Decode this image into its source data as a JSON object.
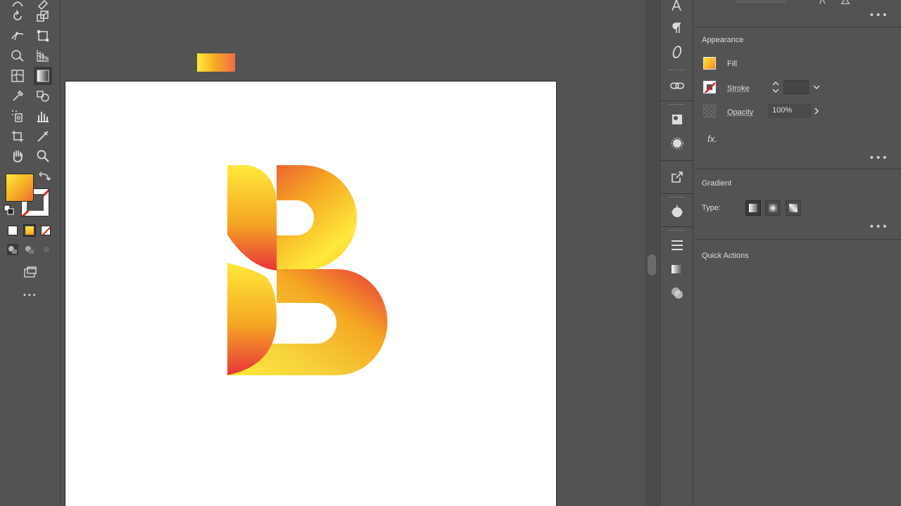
{
  "appearance": {
    "title": "Appearance",
    "fill_label": "Fill",
    "stroke_label": "Stroke",
    "opacity_label": "Opacity",
    "opacity_value": "100%",
    "fx_label": "fx."
  },
  "gradient": {
    "title": "Gradient",
    "type_label": "Type:"
  },
  "quick_actions": {
    "title": "Quick Actions"
  },
  "more_label": "•••",
  "tool_more_label": "•••",
  "colors": {
    "ui_background": "#535353",
    "artboard": "#ffffff",
    "gradient_yellow": "#FFE93B",
    "gradient_orange": "#F5A623",
    "gradient_red": "#E8343B"
  }
}
